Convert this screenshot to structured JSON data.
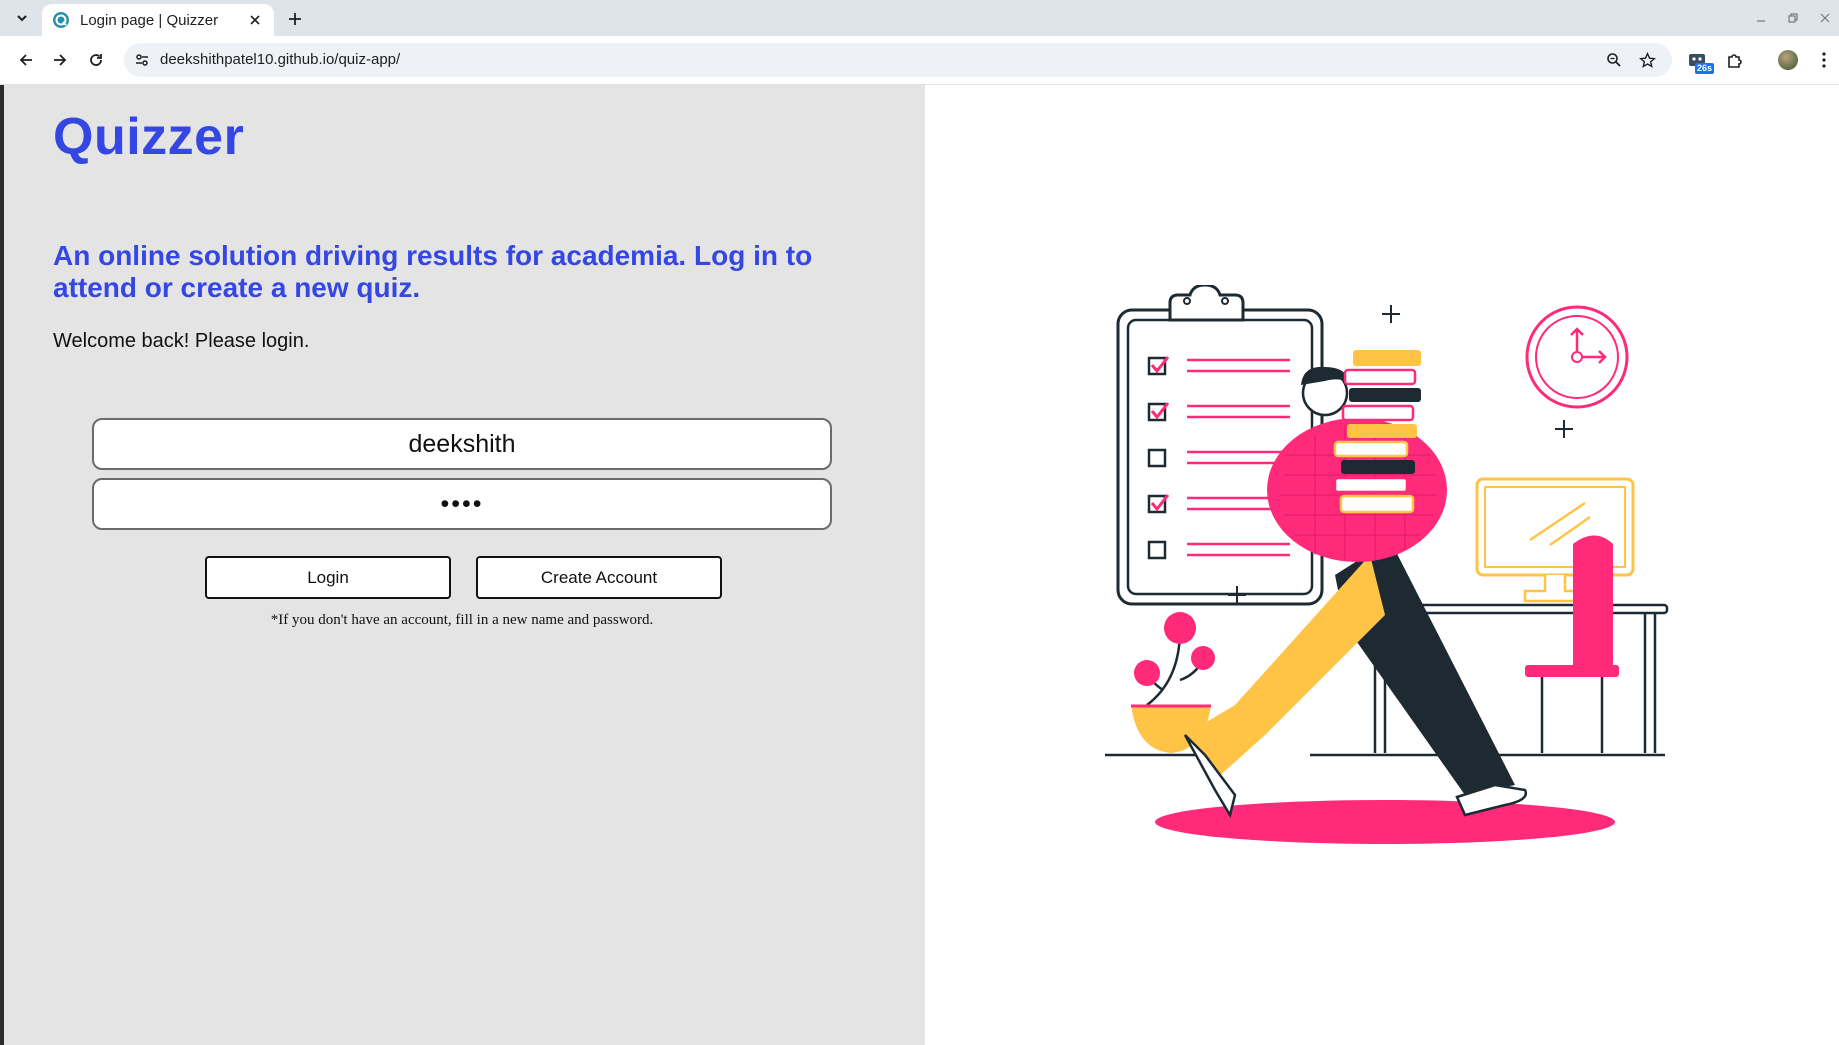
{
  "browser": {
    "tab_title": "Login page | Quizzer",
    "url": "deekshithpatel10.github.io/quiz-app/",
    "extension_badge": "26s",
    "icons": {
      "tab_list": "chevron-down-icon",
      "favicon": "quizzer-favicon",
      "tab_close": "close-icon",
      "new_tab": "plus-icon",
      "back": "arrow-left-icon",
      "forward": "arrow-right-icon",
      "reload": "reload-icon",
      "site_info": "tune-icon",
      "zoom": "zoom-icon",
      "bookmark": "star-icon",
      "extensions": "puzzle-icon",
      "menu": "kebab-menu-icon"
    }
  },
  "page": {
    "brand": "Quizzer",
    "tagline": "An online solution driving results for academia. Log in to attend or create a new quiz.",
    "welcome": "Welcome back! Please login.",
    "form": {
      "username_value": "deekshith",
      "password_value": "1234",
      "login_label": "Login",
      "create_label": "Create Account",
      "hint": "*If you don't have an account, fill in a new name and password."
    }
  },
  "colors": {
    "brand_blue": "#3447e3",
    "panel_gray": "#e4e4e4",
    "illustration_pink": "#ff2a7a",
    "illustration_yellow": "#ffc445",
    "illustration_dark": "#1e2a32"
  }
}
